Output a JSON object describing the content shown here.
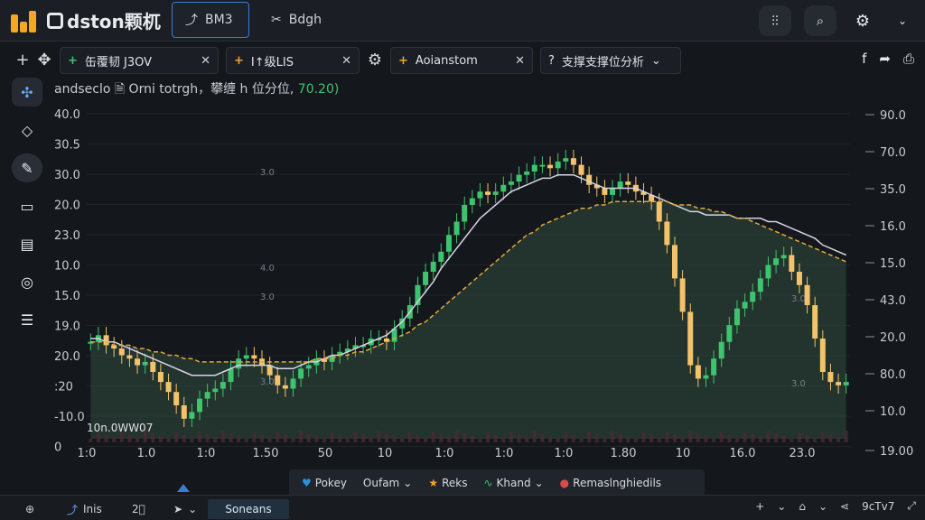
{
  "app": {
    "title": "dston颗杌"
  },
  "top_tabs": [
    {
      "label": "BM3",
      "icon": "trend-line-icon"
    },
    {
      "label": "Bdgh",
      "icon": "tools-icon"
    }
  ],
  "chart_tabs": [
    {
      "label": "缶覆韧 J3OV",
      "marker": "+"
    },
    {
      "label": "I↑级LIS",
      "marker": "+"
    },
    {
      "label": "Aoianstom",
      "marker": "+"
    },
    {
      "label": "支撑支撑位分析",
      "marker": "?"
    }
  ],
  "legend": {
    "text": "andseclo 🗎 Orni totrgh，攀缠 h 位分位,",
    "value": "70.20)"
  },
  "chart_data": {
    "type": "candlestick",
    "y_left_ticks": [
      "40.0",
      "30.5",
      "30.0",
      "20.0",
      "23.0",
      "10.0",
      "15.0",
      "19.0",
      "20.0",
      ":20",
      "-10.0",
      "0"
    ],
    "y_right_ticks": [
      "90.0",
      "70.0",
      "35.0",
      "16.0",
      "15.0",
      "43.0",
      "20.0",
      "80.0",
      "10.0",
      "19.00"
    ],
    "x_ticks": [
      "1:0",
      "1.0",
      "1:0",
      "1.50",
      "50",
      "10",
      "1:0",
      "1:0",
      "1:0",
      "1.80",
      "10",
      "16.0",
      "23.0"
    ],
    "inner_labels": [
      "3.0",
      "4.0",
      "3.0",
      "3.0",
      "3.0",
      "3.0"
    ],
    "volume_label": "10n.0WW07",
    "close": [
      29,
      31,
      28,
      27,
      25,
      24,
      22,
      23,
      20,
      17,
      14,
      10,
      6,
      8,
      12,
      14,
      15,
      17,
      21,
      24,
      25,
      24,
      22,
      19,
      16,
      15,
      18,
      21,
      22,
      24,
      23,
      25,
      26,
      27,
      28,
      28,
      30,
      30,
      29,
      33,
      36,
      40,
      46,
      50,
      53,
      56,
      61,
      65,
      70,
      72,
      74,
      73,
      74,
      76,
      77,
      79,
      80,
      82,
      82,
      81,
      83,
      84,
      82,
      79,
      76,
      75,
      73,
      75,
      77,
      76,
      74,
      73,
      71,
      65,
      58,
      48,
      38,
      22,
      18,
      19,
      24,
      29,
      34,
      39,
      41,
      44,
      48,
      52,
      54,
      55,
      50,
      46,
      40,
      30,
      20,
      17,
      16,
      17
    ],
    "ma_fast": [
      30,
      30,
      29,
      29,
      28,
      27,
      26,
      25,
      24,
      23,
      22,
      21,
      20,
      19,
      19,
      19,
      19,
      20,
      21,
      22,
      22,
      22,
      22,
      22,
      21,
      21,
      21,
      22,
      23,
      23,
      24,
      25,
      25,
      26,
      27,
      28,
      29,
      30,
      31,
      33,
      35,
      38,
      41,
      44,
      47,
      51,
      54,
      57,
      60,
      63,
      66,
      68,
      70,
      72,
      74,
      75,
      76,
      77,
      78,
      78,
      79,
      79,
      79,
      78,
      77,
      76,
      75,
      75,
      75,
      75,
      75,
      74,
      73,
      72,
      71,
      70,
      69,
      68,
      68,
      67,
      67,
      67,
      67,
      66,
      66,
      66,
      66,
      65,
      65,
      64,
      63,
      62,
      61,
      60,
      58,
      57,
      56,
      55
    ],
    "ma_slow": [
      29,
      29,
      29,
      28,
      28,
      28,
      27,
      27,
      26,
      26,
      25,
      25,
      24,
      24,
      23,
      23,
      23,
      23,
      23,
      23,
      23,
      23,
      23,
      23,
      23,
      23,
      23,
      23,
      23,
      24,
      24,
      24,
      25,
      25,
      26,
      26,
      27,
      28,
      29,
      30,
      31,
      32,
      34,
      35,
      37,
      39,
      41,
      43,
      45,
      47,
      49,
      51,
      53,
      55,
      57,
      59,
      61,
      62,
      64,
      65,
      66,
      67,
      68,
      69,
      69,
      70,
      70,
      71,
      71,
      71,
      71,
      71,
      71,
      71,
      71,
      70,
      70,
      70,
      69,
      69,
      68,
      68,
      67,
      66,
      66,
      65,
      64,
      63,
      62,
      61,
      60,
      59,
      58,
      57,
      56,
      55,
      54,
      53
    ],
    "ylim": [
      0,
      100
    ]
  },
  "bottom_tools": [
    {
      "label": "Pokey",
      "icon": "heart-icon"
    },
    {
      "label": "Oufam",
      "icon": ""
    },
    {
      "label": "Reks",
      "icon": "star-icon"
    },
    {
      "label": "Khand",
      "icon": "wave-icon"
    },
    {
      "label": "Remaslnghiedils",
      "icon": "record-icon"
    }
  ],
  "statusbar": {
    "items": [
      "Inis",
      "2⃣"
    ],
    "selected": "Soneans",
    "right_text": "9cTv7"
  },
  "colors": {
    "up": "#3ec46d",
    "down": "#f2c36b",
    "accent": "#3a7bd5",
    "area": "#2f4a3d"
  }
}
